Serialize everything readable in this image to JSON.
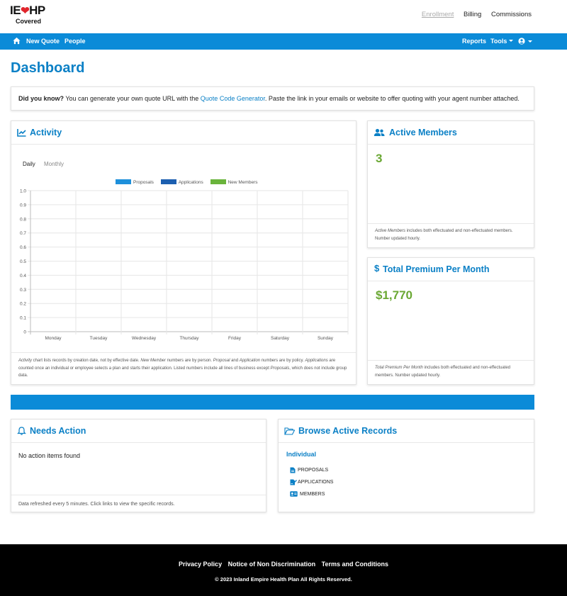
{
  "brand": {
    "logo_main_left": "IE",
    "logo_main_right": "HP",
    "logo_sub": "Covered",
    "accent_color": "#0b8bd8",
    "heart_color": "#e0252c",
    "green_color": "#6aa833"
  },
  "top_nav": {
    "enrollment": "Enrollment",
    "billing": "Billing",
    "commissions": "Commissions"
  },
  "blue_nav": {
    "home_icon": "home-icon",
    "new_quote": "New Quote",
    "people": "People",
    "reports": "Reports",
    "tools": "Tools",
    "user_icon": "user-circle-icon"
  },
  "page_title": "Dashboard",
  "tip": {
    "lead": "Did you know?",
    "text_before": " You can generate your own quote URL with the ",
    "link": "Quote Code Generator",
    "text_after": ". Paste the link in your emails or website to offer quoting with your agent number attached."
  },
  "activity": {
    "title": "Activity",
    "tabs": [
      "Daily",
      "Monthly"
    ],
    "active_tab": "Daily",
    "footnote": {
      "p1": "Activity",
      "p2": " chart lists records by creation date, not by effective date. ",
      "p3": "New Member",
      "p4": " numbers are by person. ",
      "p5": "Proposal",
      "p6": " and ",
      "p7": "Application",
      "p8": " numbers are by policy. ",
      "p9": "Applications",
      "p10": " are counted once an individual or employee selects a plan and starts their application. Listed numbers include all lines of business except ",
      "p11": "Proposals",
      "p12": ", which does not include group data."
    }
  },
  "chart_data": {
    "type": "bar",
    "categories": [
      "Monday",
      "Tuesday",
      "Wednesday",
      "Thursday",
      "Friday",
      "Saturday",
      "Sunday"
    ],
    "series": [
      {
        "name": "Proposals",
        "values": [
          0,
          0,
          0,
          0,
          0,
          0,
          0
        ],
        "color": "#1e90db"
      },
      {
        "name": "Applications",
        "values": [
          0,
          0,
          0,
          0,
          0,
          0,
          0
        ],
        "color": "#1c5fb0"
      },
      {
        "name": "New Members",
        "values": [
          0,
          0,
          0,
          0,
          0,
          0,
          0
        ],
        "color": "#6ab43c"
      }
    ],
    "yticks": [
      "0",
      "0.1",
      "0.2",
      "0.3",
      "0.4",
      "0.5",
      "0.6",
      "0.7",
      "0.8",
      "0.9",
      "1.0"
    ],
    "ylim": [
      0,
      1.0
    ],
    "grid": true,
    "legend": "top-center"
  },
  "members": {
    "title": "Active Members",
    "value": "3",
    "note_em": "Active Members",
    "note": " includes both effectuated and non-effectuated members. Number updated hourly."
  },
  "premium": {
    "title": "Total Premium Per Month",
    "value": "$1,770",
    "note_em": "Total Premium Per Month",
    "note": " includes both effectuated and non-effectuated members. Number updated hourly."
  },
  "needs_action": {
    "title": "Needs Action",
    "body": "No action items found",
    "footer": "Data refreshed every 5 minutes. Click links to view the specific records."
  },
  "browse": {
    "title": "Browse Active Records",
    "subtitle": "Individual",
    "items": [
      "PROPOSALS",
      "APPLICATIONS",
      "MEMBERS"
    ]
  },
  "footer": {
    "links": [
      "Privacy Policy",
      "Notice of Non Discrimination",
      "Terms and Conditions"
    ],
    "copyright": "© 2023 Inland Empire Health Plan All Rights Reserved."
  }
}
